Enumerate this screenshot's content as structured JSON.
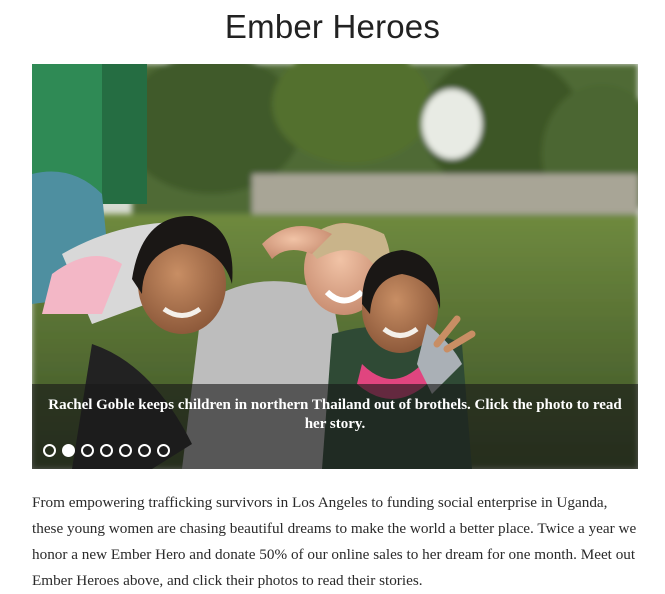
{
  "page": {
    "title": "Ember Heroes"
  },
  "slider": {
    "caption": "Rachel Goble keeps children in northern Thailand out of brothels. Click the photo to read her story.",
    "dot_count": 7,
    "active_dot": 2
  },
  "blurb": {
    "text": "From empowering trafficking survivors in Los Angeles to funding social enterprise in Uganda, these young women are chasing beautiful dreams to make the world a better place. Twice a year we honor a new Ember Hero and donate 50% of our online sales to her dream for one month. Meet out Ember Heroes above, and click their photos to read their stories."
  },
  "colors": {
    "title_text": "#222222",
    "body_text": "#2a2a2a",
    "caption_overlay": "rgba(25,25,25,0.62)"
  }
}
